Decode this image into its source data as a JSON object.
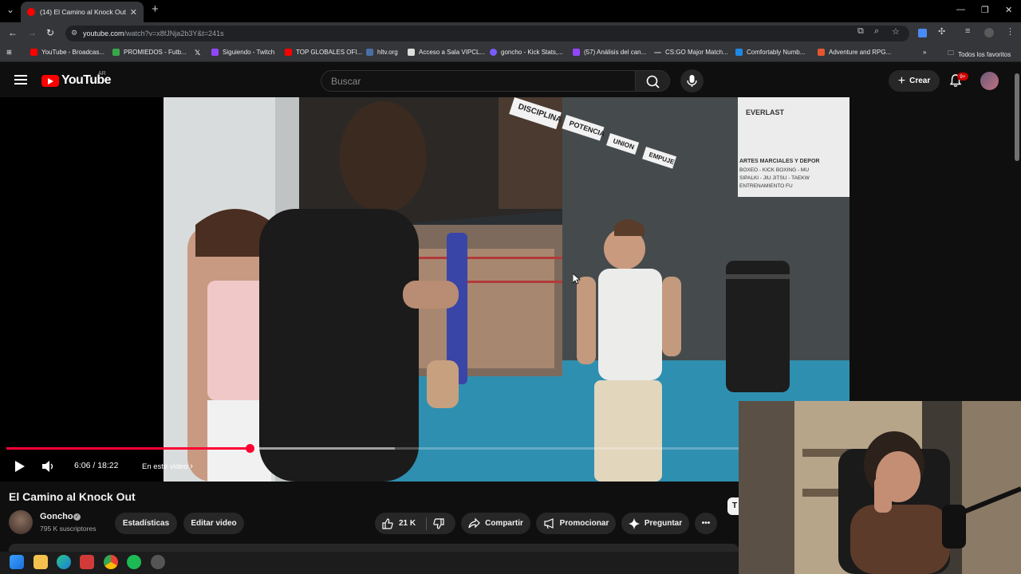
{
  "browser": {
    "tab_title": "(14) El Camino al Knock Out",
    "url_host": "youtube.com",
    "url_path": "/watch?v=x8fJNja2b3Y&t=241s",
    "bookmarks": [
      {
        "label": "YouTube - Broadcas...",
        "color": "#ff0000"
      },
      {
        "label": "PROMIEDOS - Futb...",
        "color": "#3aa64a"
      },
      {
        "label": "",
        "color": "#000000"
      },
      {
        "label": "Siguiendo - Twitch",
        "color": "#9146ff"
      },
      {
        "label": "TOP GLOBALES OFI...",
        "color": "#ff0000"
      },
      {
        "label": "hltv.org",
        "color": "#4a6fa5"
      },
      {
        "label": "Acceso a Sala VIPCL...",
        "color": "#dddddd"
      },
      {
        "label": "goncho - Kick Stats,...",
        "color": "#7b5cff"
      },
      {
        "label": "(57) Análisis del can...",
        "color": "#9146ff"
      },
      {
        "label": "CS:GO Major Match...",
        "color": "#888888"
      },
      {
        "label": "Comfortably Numb...",
        "color": "#1e88e5"
      },
      {
        "label": "Adventure and RPG...",
        "color": "#e4572e"
      }
    ],
    "all_bookmarks_label": "Todos los favoritos"
  },
  "youtube": {
    "logo_text": "YouTube",
    "region": "AR",
    "search_placeholder": "Buscar",
    "create_label": "Crear",
    "notifications_badge": "9+"
  },
  "player": {
    "current_time": "6:06",
    "duration": "18:22",
    "time_display": "6:06 / 18:22",
    "chapter_label": "En este video",
    "progress_fraction": 0.332,
    "buffered_fraction": 0.53
  },
  "video": {
    "title": "El Camino al Knock Out",
    "channel_name": "Goncho",
    "subscribers": "795 K suscriptores",
    "stats_button": "Estadísticas",
    "edit_button": "Editar video",
    "likes": "21 K",
    "share_label": "Compartir",
    "promote_label": "Promocionar",
    "ask_label": "Preguntar",
    "side_tab_label": "T"
  },
  "scene_signs": {
    "banner_1": "DISCIPLINA",
    "banner_2": "POTENCIA",
    "banner_3": "UNION",
    "banner_4": "EMPUJE",
    "brand": "EVERLAST",
    "board_line_1": "ARTES MARCIALES Y DEPOR",
    "board_line_2": "BOXEO - KICK BOXING - MU",
    "board_line_3": "SIPALKI - JIU JITSU - TAEKW",
    "board_line_4": "ENTRENAMIENTO FU"
  },
  "colors": {
    "accent_red": "#ff0033",
    "youtube_red": "#ff0000",
    "background": "#0f0f0f",
    "chip": "#272727"
  }
}
